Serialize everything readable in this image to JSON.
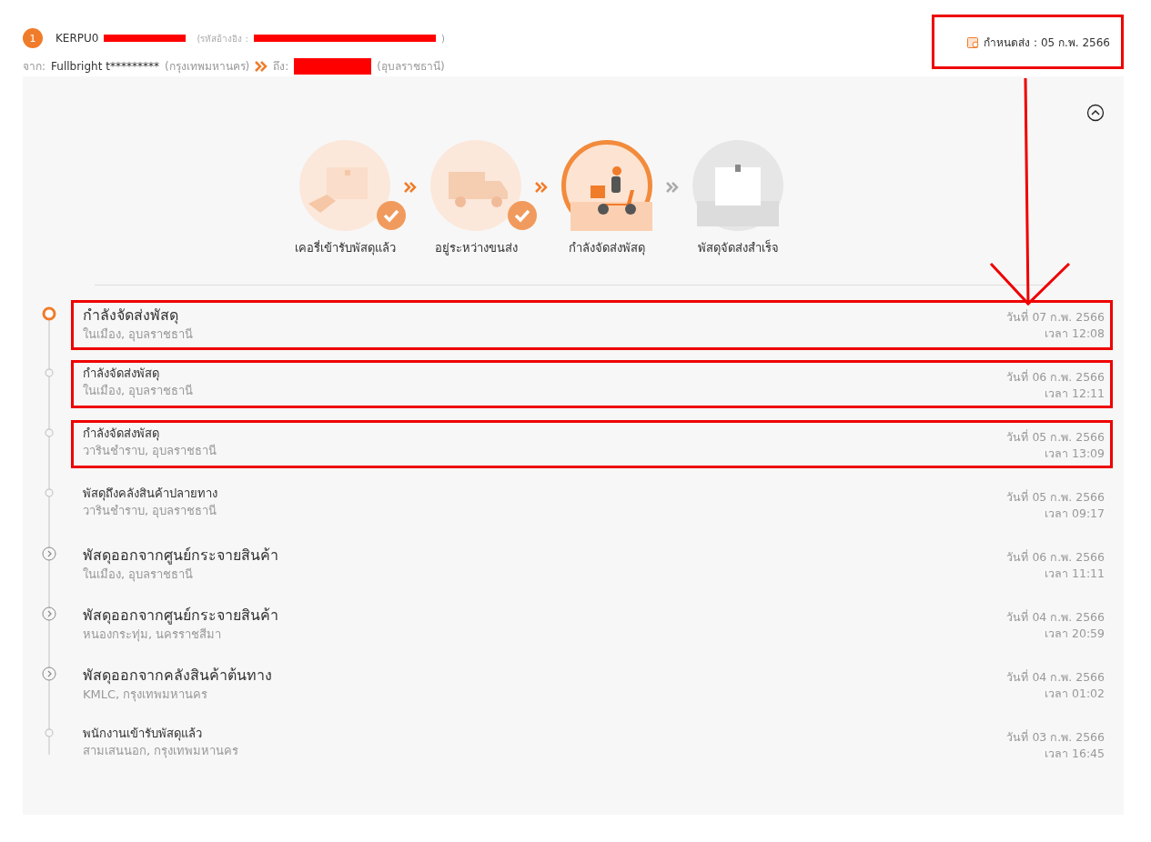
{
  "shipment": {
    "index": "1",
    "tracking_prefix": "KERPU0",
    "ref_label": "(รหัสอ้างอิง :",
    "ref_close": ")",
    "from_label": "จาก:",
    "sender": "Fullbright t*********",
    "from_city": "(กรุงเทพมหานคร)",
    "to_label": "ถึง:",
    "to_city": "(อุบลราชธานี)"
  },
  "deadline": {
    "text": "กำหนดส่ง : 05 ก.พ. 2566",
    "annotated": true
  },
  "panel": {
    "expanded": true
  },
  "steps": [
    {
      "label": "เคอรี่เข้ารับพัสดุแล้ว",
      "completed": true,
      "active": false,
      "kind": "pickup"
    },
    {
      "label": "อยู่ระหว่างขนส่ง",
      "completed": true,
      "active": false,
      "kind": "truck"
    },
    {
      "label": "กำลังจัดส่งพัสดุ",
      "completed": false,
      "active": true,
      "kind": "scooter"
    },
    {
      "label": "พัสดุจัดส่งสำเร็จ",
      "completed": false,
      "active": false,
      "kind": "box"
    }
  ],
  "events": [
    {
      "kind": "current",
      "title": "กำลังจัดส่งพัสดุ",
      "place": "ในเมือง, อุบลราชธานี",
      "date": "วันที่ 07 ก.พ. 2566",
      "time": "เวลา 12:08",
      "annotated": true
    },
    {
      "kind": "minor",
      "title": "กำลังจัดส่งพัสดุ",
      "place": "ในเมือง, อุบลราชธานี",
      "date": "วันที่ 06 ก.พ. 2566",
      "time": "เวลา 12:11",
      "annotated": true
    },
    {
      "kind": "minor",
      "title": "กำลังจัดส่งพัสดุ",
      "place": "วารินชำราบ, อุบลราชธานี",
      "date": "วันที่ 05 ก.พ. 2566",
      "time": "เวลา 13:09",
      "annotated": true
    },
    {
      "kind": "minor",
      "title": "พัสดุถึงคลังสินค้าปลายทาง",
      "place": "วารินชำราบ, อุบลราชธานี",
      "date": "วันที่ 05 ก.พ. 2566",
      "time": "เวลา 09:17",
      "annotated": false
    },
    {
      "kind": "hub",
      "title": "พัสดุออกจากศูนย์กระจายสินค้า",
      "place": "ในเมือง, อุบลราชธานี",
      "date": "วันที่ 06 ก.พ. 2566",
      "time": "เวลา 11:11",
      "annotated": false
    },
    {
      "kind": "hub",
      "title": "พัสดุออกจากศูนย์กระจายสินค้า",
      "place": "หนองกระทุ่ม, นครราชสีมา",
      "date": "วันที่ 04 ก.พ. 2566",
      "time": "เวลา 20:59",
      "annotated": false
    },
    {
      "kind": "hub",
      "title": "พัสดุออกจากคลังสินค้าต้นทาง",
      "place": "KMLC, กรุงเทพมหานคร",
      "date": "วันที่ 04 ก.พ. 2566",
      "time": "เวลา 01:02",
      "annotated": false
    },
    {
      "kind": "minor",
      "title": "พนักงานเข้ารับพัสดุแล้ว",
      "place": "สามเสนนอก, กรุงเทพมหานคร",
      "date": "วันที่ 03 ก.พ. 2566",
      "time": "เวลา 16:45",
      "annotated": false
    }
  ]
}
